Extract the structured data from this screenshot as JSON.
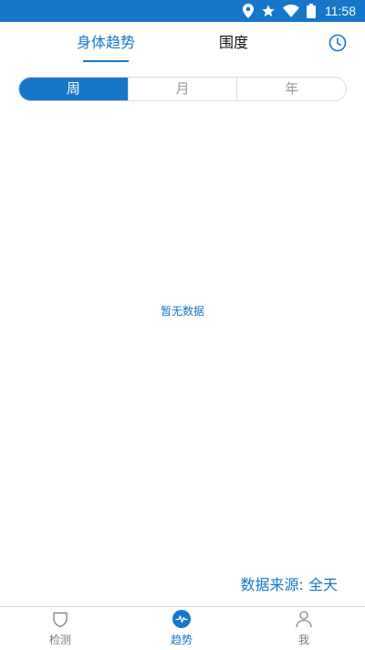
{
  "status_bar": {
    "time": "11:58",
    "icons": [
      "location-icon",
      "star-icon",
      "wifi-icon",
      "battery-icon"
    ],
    "background": "#1677c8"
  },
  "tabs": [
    {
      "label": "身体趋势",
      "active": true
    },
    {
      "label": "围度",
      "active": false
    }
  ],
  "history_icon": "clock-icon",
  "period_selector": {
    "options": [
      "周",
      "月",
      "年"
    ],
    "selected": "周"
  },
  "empty_message": "暂无数据",
  "data_source": "数据来源: 全天",
  "bottom_nav": [
    {
      "label": "检测",
      "icon": "shield-icon",
      "active": false
    },
    {
      "label": "趋势",
      "icon": "pulse-icon",
      "active": true
    },
    {
      "label": "我",
      "icon": "person-icon",
      "active": false
    }
  ],
  "colors": {
    "accent": "#1677c8",
    "inactive_text": "#9a9a9a"
  }
}
